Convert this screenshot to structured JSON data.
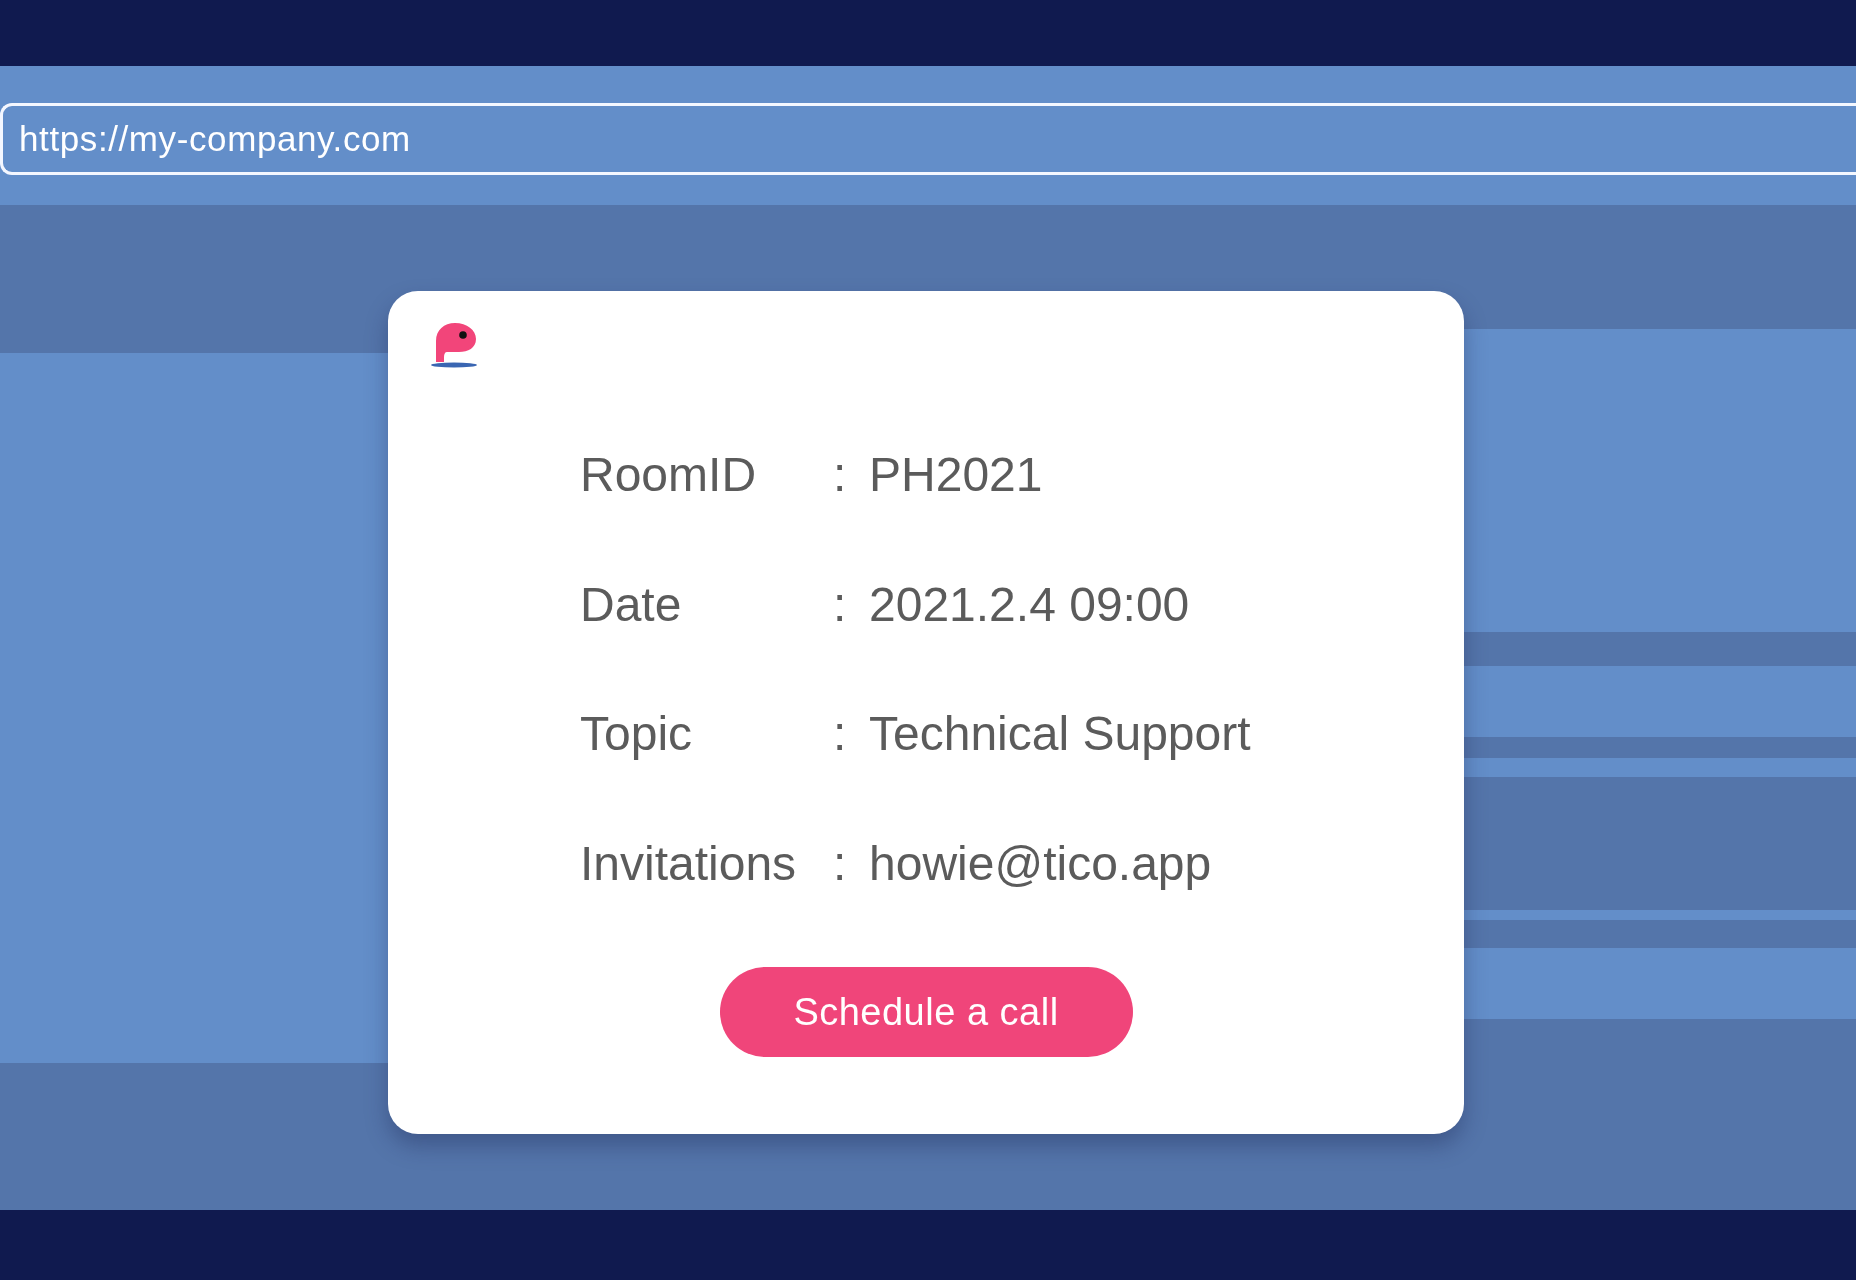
{
  "address_bar": {
    "value": "https://my-company.com"
  },
  "card": {
    "rows": [
      {
        "label": "RoomID",
        "separator": ":",
        "value": "PH2021"
      },
      {
        "label": "Date",
        "separator": ":",
        "value": "2021.2.4 09:00"
      },
      {
        "label": "Topic",
        "separator": ":",
        "value": "Technical Support"
      },
      {
        "label": "Invitations",
        "separator": ":",
        "value": "howie@tico.app"
      }
    ],
    "button": {
      "label": "Schedule a call"
    }
  }
}
